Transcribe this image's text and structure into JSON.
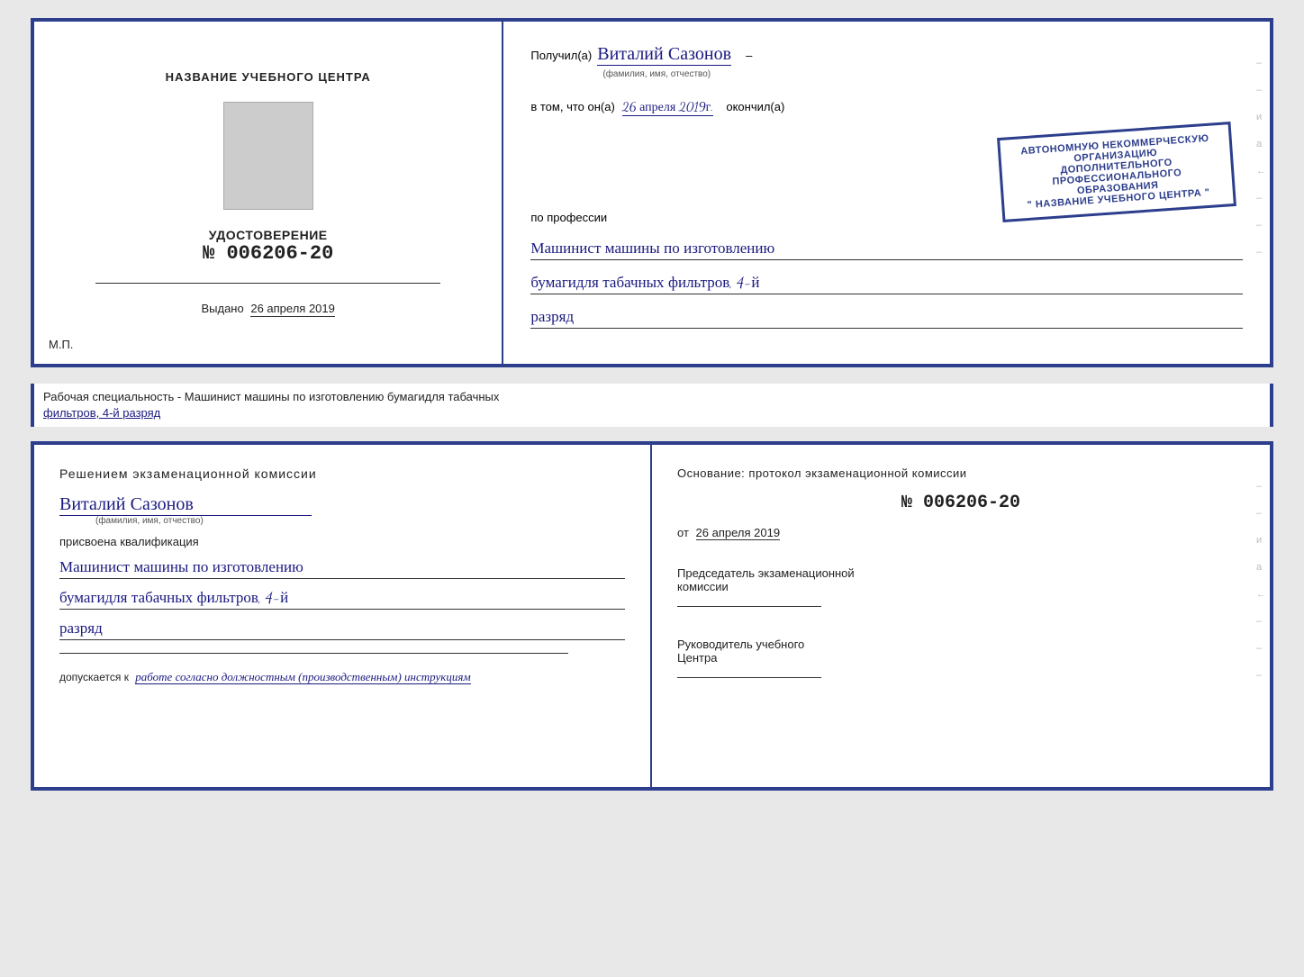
{
  "topCert": {
    "leftSection": {
      "headerLabel": "НАЗВАНИЕ УЧЕБНОГО ЦЕНТРА",
      "udostoverenie": "УДОСТОВЕРЕНИЕ",
      "number": "№ 006206-20",
      "vydano": "Выдано",
      "vydanoDate": "26 апреля 2019",
      "mp": "М.П."
    },
    "rightSection": {
      "poluchil": "Получил(а)",
      "name": "Виталий Сазонов",
      "nameSub": "(фамилия, имя, отчество)",
      "vtomChto": "в том, что он(а)",
      "date": "26 апреля 2019г.",
      "okonchil": "окончил(а)",
      "stampLine1": "АВТОНОМНУЮ НЕКОММЕРЧЕСКУЮ ОРГАНИЗАЦИЮ",
      "stampLine2": "ДОПОЛНИТЕЛЬНОГО ПРОФЕССИОНАЛЬНОГО ОБРАЗОВАНИЯ",
      "stampLine3": "\" НАЗВАНИЕ УЧЕБНОГО ЦЕНТРА \"",
      "poProfessii": "по профессии",
      "profession1": "Машинист машины по изготовлению",
      "profession2": "бумагидля табачных фильтров, 4-й",
      "profession3": "разряд"
    }
  },
  "labelBetween": {
    "text": "Рабочая специальность - Машинист машины по изготовлению бумагидля табачных",
    "underlineText": "фильтров, 4-й разряд"
  },
  "bottomCert": {
    "leftSection": {
      "resheniem": "Решением экзаменационной комиссии",
      "name": "Виталий Сазонов",
      "nameSub": "(фамилия, имя, отчество)",
      "prisvoena": "присвоена квалификация",
      "qualification1": "Машинист машины по изготовлению",
      "qualification2": "бумагидля табачных фильтров, 4-й",
      "qualification3": "разряд",
      "dopuskaetsya": "допускается к",
      "dopuskText": "работе согласно должностным (производственным) инструкциям"
    },
    "rightSection": {
      "osnovanie": "Основание: протокол экзаменационной комиссии",
      "number": "№  006206-20",
      "ot": "от",
      "otDate": "26 апреля 2019",
      "predsedatel1": "Председатель экзаменационной",
      "predsedatel2": "комиссии",
      "rukovoditel1": "Руководитель учебного",
      "rukovoditel2": "Центра"
    }
  },
  "sideMarks": {
    "marks": [
      "–",
      "–",
      "и",
      "а",
      "←",
      "–",
      "–",
      "–"
    ]
  }
}
